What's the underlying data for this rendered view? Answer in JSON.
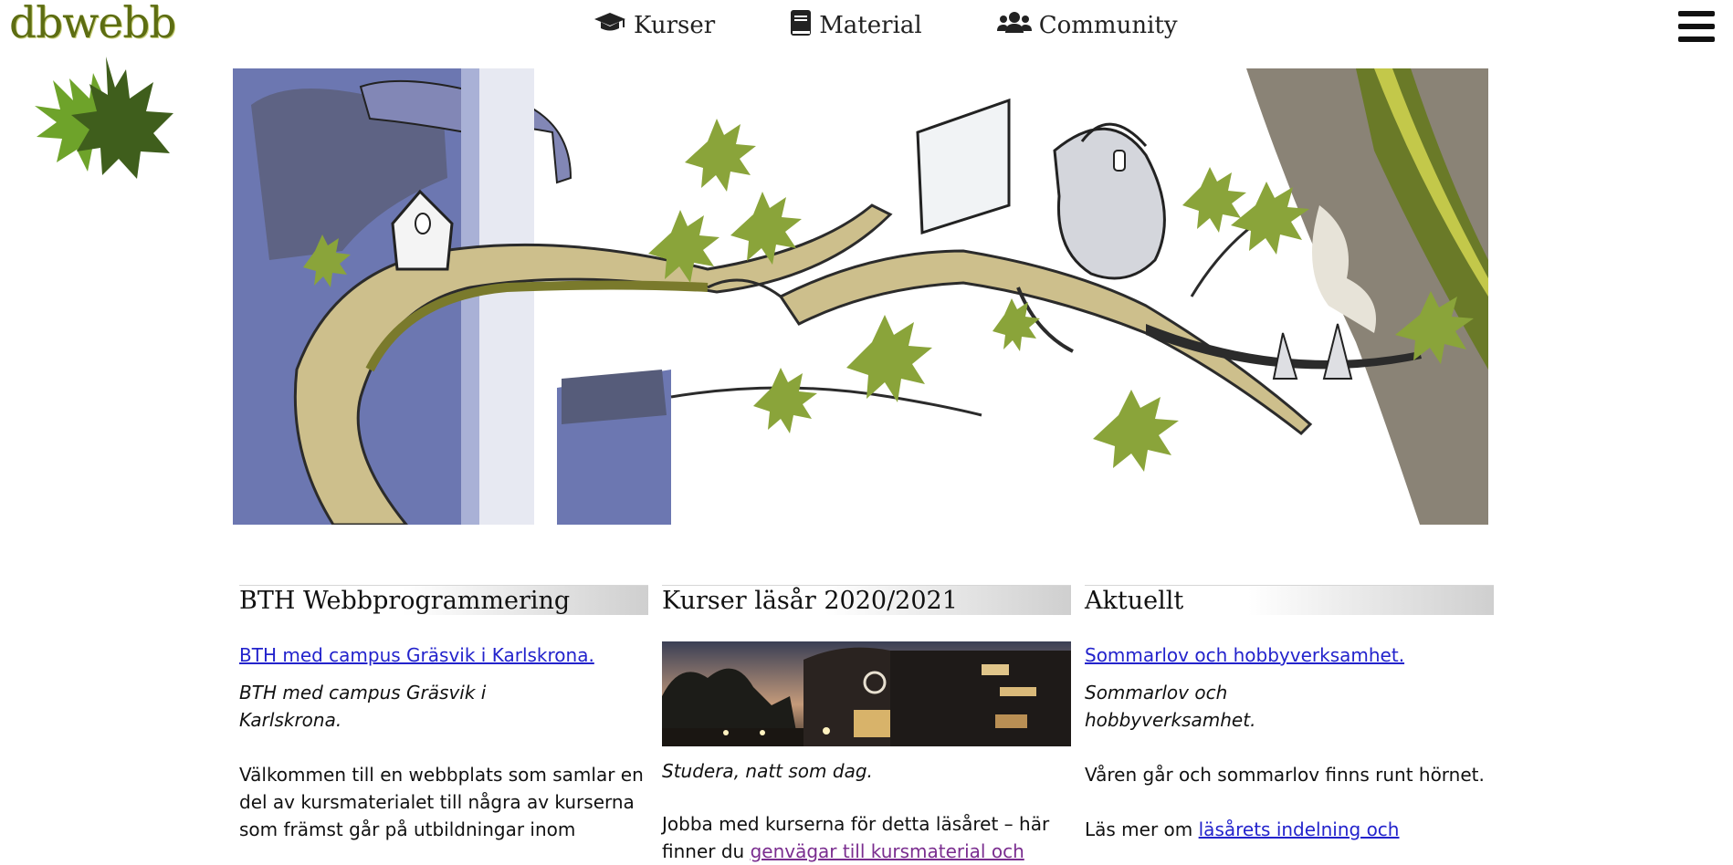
{
  "site": {
    "logo_text": "dbwebb"
  },
  "nav": {
    "items": [
      {
        "label": "Kurser",
        "icon": "graduation-cap-icon"
      },
      {
        "label": "Material",
        "icon": "book-icon"
      },
      {
        "label": "Community",
        "icon": "users-icon"
      }
    ],
    "menu_icon": "hamburger-menu-icon"
  },
  "hero": {
    "image": "illustration of tree branch with maple leaves, birdhouse and figure with headset at a computer"
  },
  "columns": [
    {
      "title": "BTH Webbprogrammering",
      "link": "BTH med campus Gräsvik i Karlskrona.",
      "teaser_line1": "BTH med campus Gräsvik i",
      "teaser_line2": "Karlskrona.",
      "body_line1": "Välkommen till en webbplats som samlar en",
      "body_line2": "del av kursmaterialet till några av kurserna",
      "body_line3": "som främst går på utbildningar inom"
    },
    {
      "title": "Kurser läsår 2020/2021",
      "caption": "Studera, natt som dag.",
      "body_line1": "Jobba med kurserna för detta läsåret – här",
      "body_line2_prefix": "finner du ",
      "body_line2_link": "genvägar till kursmaterial och"
    },
    {
      "title": "Aktuellt",
      "link": "Sommarlov och hobbyverksamhet.",
      "teaser_line1": "Sommarlov och",
      "teaser_line2": "hobbyverksamhet.",
      "body_line1": "Våren går och sommarlov finns runt hörnet.",
      "body_line2_prefix": "Läs mer om ",
      "body_line2_link": "läsårets indelning och"
    }
  ],
  "colors": {
    "link": "#2323cc",
    "visited_link": "#7a2d8f",
    "logo": "#5d6d12"
  }
}
